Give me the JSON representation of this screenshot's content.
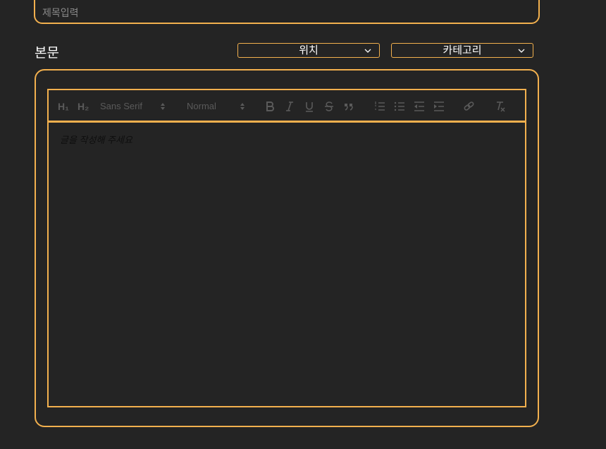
{
  "title_field": {
    "placeholder": "제목입력",
    "value": ""
  },
  "body_section": {
    "label": "본문"
  },
  "location_select": {
    "selected": "위치"
  },
  "category_select": {
    "selected": "카테고리"
  },
  "toolbar": {
    "font_family": "Sans Serif",
    "font_size": "Normal",
    "h1_label": "H₁",
    "h2_label": "H₂"
  },
  "editor": {
    "placeholder": "글을 작성해 주세요"
  },
  "colors": {
    "accent": "#f2b04e",
    "background": "#242424",
    "toolbar_icon": "#5a5a5a"
  }
}
